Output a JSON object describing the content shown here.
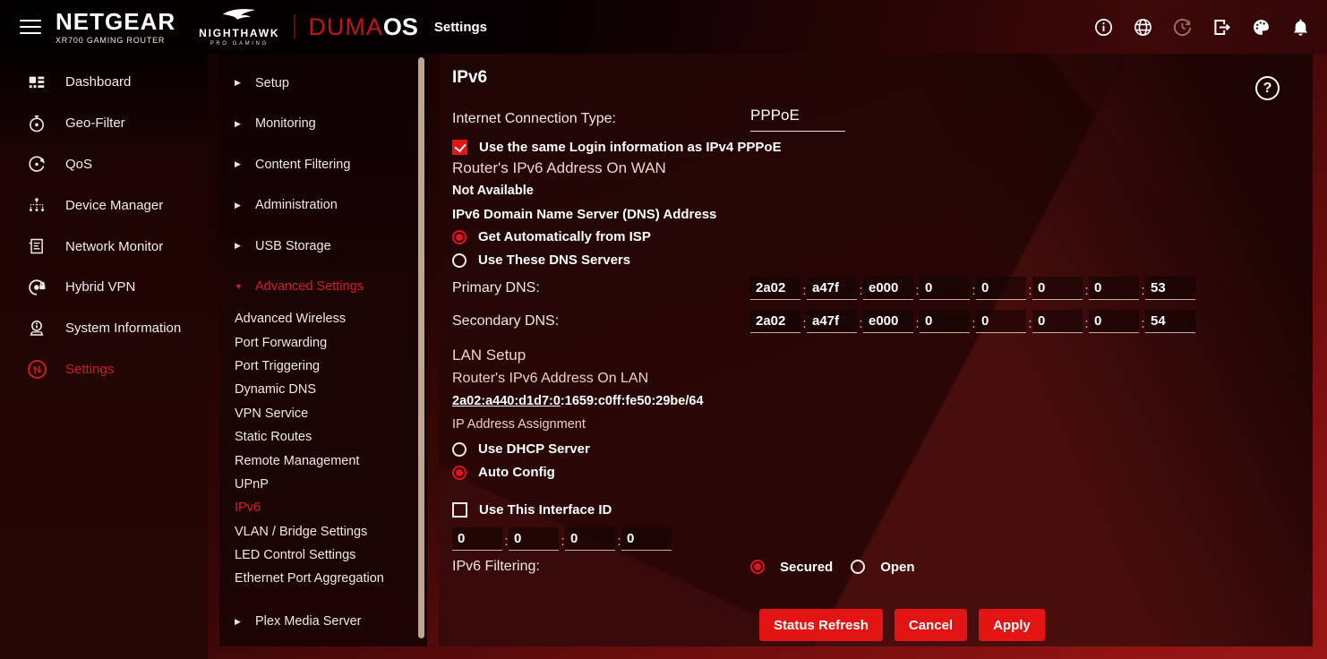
{
  "header": {
    "brand": "NETGEAR",
    "model": "XR700 GAMING ROUTER",
    "sub_brand": "NIGHTHAWK",
    "sub_brand_tagline": "PRO GAMING",
    "os_name_red": "DUMA",
    "os_name_white": "OS",
    "page_title": "Settings",
    "icons": [
      "info-icon",
      "globe-icon",
      "refresh-history-icon",
      "logout-icon",
      "theme-palette-icon",
      "notifications-bell-icon"
    ]
  },
  "sidebar": {
    "items": [
      {
        "label": "Dashboard",
        "icon": "dashboard"
      },
      {
        "label": "Geo-Filter",
        "icon": "geo-filter"
      },
      {
        "label": "QoS",
        "icon": "qos"
      },
      {
        "label": "Device Manager",
        "icon": "device-manager"
      },
      {
        "label": "Network Monitor",
        "icon": "network-monitor"
      },
      {
        "label": "Hybrid VPN",
        "icon": "hybrid-vpn"
      },
      {
        "label": "System Information",
        "icon": "system-information"
      },
      {
        "label": "Settings",
        "icon": "netduma-n",
        "active": true
      }
    ]
  },
  "submenu": {
    "items": [
      {
        "label": "Setup",
        "section": true,
        "arrow": "▶"
      },
      {
        "label": "Monitoring",
        "section": true,
        "arrow": "▶"
      },
      {
        "label": "Content Filtering",
        "section": true,
        "arrow": "▶"
      },
      {
        "label": "Administration",
        "section": true,
        "arrow": "▶"
      },
      {
        "label": "USB Storage",
        "section": true,
        "arrow": "▶"
      },
      {
        "label": "Advanced Settings",
        "section": true,
        "arrow": "▼",
        "active": true
      },
      {
        "label": "Advanced Wireless"
      },
      {
        "label": "Port Forwarding"
      },
      {
        "label": "Port Triggering"
      },
      {
        "label": "Dynamic DNS"
      },
      {
        "label": "VPN Service"
      },
      {
        "label": "Static Routes"
      },
      {
        "label": "Remote Management"
      },
      {
        "label": "UPnP"
      },
      {
        "label": "IPv6",
        "active": true
      },
      {
        "label": "VLAN / Bridge Settings"
      },
      {
        "label": "LED Control Settings"
      },
      {
        "label": "Ethernet Port Aggregation"
      },
      {
        "label": "Plex Media Server",
        "section": true,
        "arrow": "▶",
        "gap": true
      }
    ]
  },
  "main": {
    "title": "IPv6",
    "help_glyph": "?",
    "connection_label": "Internet Connection Type:",
    "connection_value": "PPPoE",
    "same_login": {
      "checked": true,
      "label": "Use the same Login information as IPv4 PPPoE"
    },
    "wan_heading": "Router's IPv6 Address On WAN",
    "wan_status": "Not Available",
    "dns_heading": "IPv6 Domain Name Server (DNS) Address",
    "dns_options": [
      {
        "label": "Get Automatically from ISP",
        "selected": true
      },
      {
        "label": "Use These DNS Servers",
        "selected": false
      }
    ],
    "primary_dns_label": "Primary DNS:",
    "primary_dns": [
      "2a02",
      "a47f",
      "e000",
      "0",
      "0",
      "0",
      "0",
      "53"
    ],
    "secondary_dns_label": "Secondary DNS:",
    "secondary_dns": [
      "2a02",
      "a47f",
      "e000",
      "0",
      "0",
      "0",
      "0",
      "54"
    ],
    "lan_heading": "LAN Setup",
    "lan_address_heading": "Router's IPv6 Address On LAN",
    "lan_address_link": "2a02:a440:d1d7:0",
    "lan_address_rest": ":1659:c0ff:fe50:29be/64",
    "assignment_label": "IP Address Assignment",
    "assignment_options": [
      {
        "label": "Use DHCP Server",
        "selected": false
      },
      {
        "label": "Auto Config",
        "selected": true
      }
    ],
    "interface_id": {
      "checked": false,
      "label": "Use This Interface ID",
      "segments": [
        "0",
        "0",
        "0",
        "0"
      ]
    },
    "filtering_label": "IPv6 Filtering:",
    "filtering_options": [
      {
        "label": "Secured",
        "selected": true
      },
      {
        "label": "Open",
        "selected": false
      }
    ],
    "buttons": {
      "status_refresh": "Status Refresh",
      "cancel": "Cancel",
      "apply": "Apply"
    }
  },
  "colors": {
    "accent_red": "#e31414",
    "active_nav_red": "#cf1d1d",
    "duma_red": "#c41515",
    "heading_rose": "#eed3d1",
    "scrollbar_tan": "#bda58f",
    "panel_bg": "#2b0606",
    "page_bg_bright": "#8f1313"
  }
}
